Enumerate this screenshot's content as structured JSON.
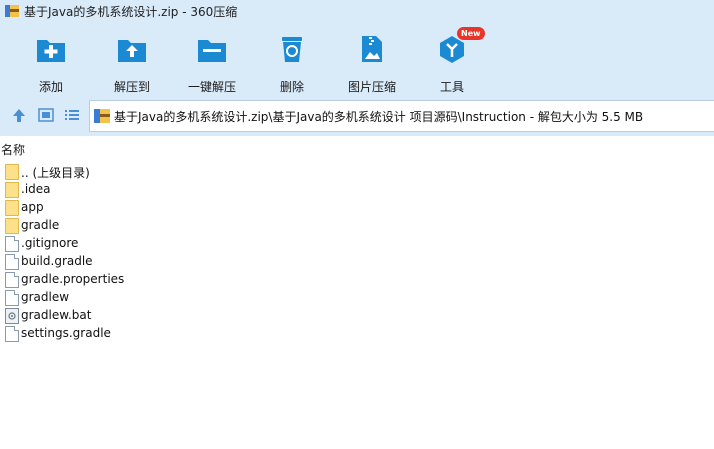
{
  "window": {
    "title": "基于Java的多机系统设计.zip - 360压缩"
  },
  "toolbar": {
    "items": [
      {
        "label": "添加",
        "icon": "add-icon"
      },
      {
        "label": "解压到",
        "icon": "extract-to-icon"
      },
      {
        "label": "一键解压",
        "icon": "one-click-extract-icon"
      },
      {
        "label": "删除",
        "icon": "delete-icon"
      },
      {
        "label": "图片压缩",
        "icon": "image-compress-icon"
      },
      {
        "label": "工具",
        "icon": "tools-icon",
        "badge": "New"
      }
    ]
  },
  "navbar": {
    "path": "基于Java的多机系统设计.zip\\基于Java的多机系统设计 项目源码\\Instruction - 解包大小为 5.5 MB"
  },
  "list": {
    "column_name": "名称",
    "items": [
      {
        "name": ".. (上级目录)",
        "type": "folder"
      },
      {
        "name": ".idea",
        "type": "folder-partial"
      },
      {
        "name": "app",
        "type": "folder"
      },
      {
        "name": "gradle",
        "type": "folder"
      },
      {
        "name": ".gitignore",
        "type": "file"
      },
      {
        "name": "build.gradle",
        "type": "file"
      },
      {
        "name": "gradle.properties",
        "type": "file"
      },
      {
        "name": "gradlew",
        "type": "file"
      },
      {
        "name": "gradlew.bat",
        "type": "bat"
      },
      {
        "name": "settings.gradle",
        "type": "file"
      }
    ]
  },
  "colors": {
    "toolbar_bg": "#d9eaf9",
    "icon_blue": "#1b8ad3",
    "badge_red": "#e8352a",
    "folder_yellow": "#fde08a"
  }
}
